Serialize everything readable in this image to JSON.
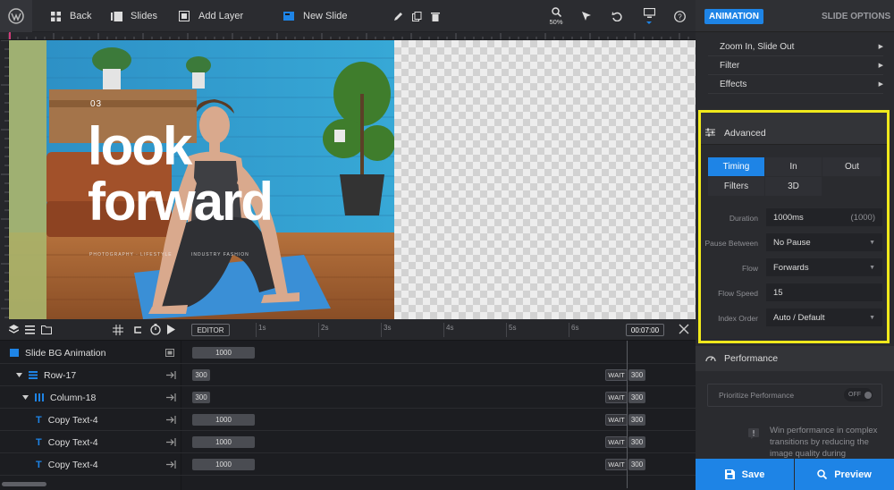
{
  "toolbar": {
    "back_label": "Back",
    "slides_label": "Slides",
    "add_layer_label": "Add Layer",
    "new_slide_label": "New Slide",
    "zoom_level": "50%"
  },
  "canvas": {
    "slide_number": "03",
    "headline_line1": "look",
    "headline_line2": "forward",
    "small_text_1": "PHOTOGRAPHY · LIFESTYLE",
    "small_text_2": "INDUSTRY FASHION"
  },
  "timeline": {
    "editor_label": "EDITOR",
    "time_marks": [
      "1s",
      "2s",
      "3s",
      "4s",
      "5s",
      "6s"
    ],
    "end_time": "00:07:00",
    "rows": [
      {
        "name": "Slide BG Animation",
        "bar": "1000",
        "wait": "",
        "wait_value": ""
      },
      {
        "name": "Row-17",
        "bar": "300",
        "wait": "WAIT",
        "wait_value": "300"
      },
      {
        "name": "Column-18",
        "bar": "300",
        "wait": "WAIT",
        "wait_value": "300"
      },
      {
        "name": "Copy Text-4",
        "bar": "1000",
        "wait": "WAIT",
        "wait_value": "300"
      },
      {
        "name": "Copy Text-4",
        "bar": "1000",
        "wait": "WAIT",
        "wait_value": "300"
      },
      {
        "name": "Copy Text-4",
        "bar": "1000",
        "wait": "WAIT",
        "wait_value": "300"
      }
    ]
  },
  "panel": {
    "tab_animation": "ANIMATION",
    "tab_slide_options": "SLIDE OPTIONS",
    "menu_items": [
      "Zoom In, Slide Out",
      "Filter",
      "Effects"
    ],
    "advanced_title": "Advanced",
    "segments": [
      "Timing",
      "In",
      "Out",
      "Filters",
      "3D"
    ],
    "fields": {
      "duration_label": "Duration",
      "duration_value": "1000ms",
      "duration_default": "(1000)",
      "pause_label": "Pause Between",
      "pause_value": "No Pause",
      "flow_label": "Flow",
      "flow_value": "Forwards",
      "flow_speed_label": "Flow Speed",
      "flow_speed_value": "15",
      "index_label": "Index Order",
      "index_value": "Auto / Default"
    },
    "performance_title": "Performance",
    "prioritize_label": "Prioritize Performance",
    "prioritize_toggle": "OFF",
    "info_text": "Win performance in complex transitions by reducing the image quality during"
  },
  "actions": {
    "save_label": "Save",
    "preview_label": "Preview"
  },
  "colors": {
    "accent": "#1e84e6",
    "highlight": "#f0e91c"
  }
}
